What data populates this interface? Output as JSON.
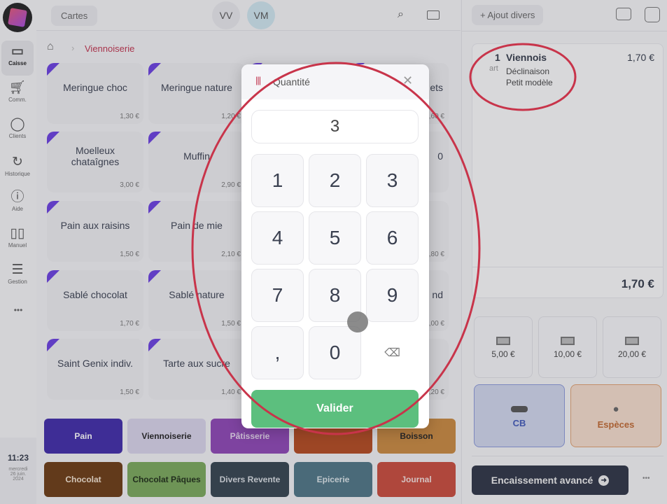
{
  "sidebar": {
    "items": [
      {
        "label": "Caisse",
        "icon": "register-icon"
      },
      {
        "label": "Comm.",
        "icon": "cart-icon"
      },
      {
        "label": "Clients",
        "icon": "user-icon"
      },
      {
        "label": "Historique",
        "icon": "history-icon"
      },
      {
        "label": "Aide",
        "icon": "help-icon"
      },
      {
        "label": "Manuel",
        "icon": "book-icon"
      },
      {
        "label": "Gestion",
        "icon": "sliders-icon"
      }
    ],
    "more": "•••",
    "time": "11:23",
    "date_line1": "mercredi",
    "date_line2": "26 juin.",
    "date_line3": "2024"
  },
  "header": {
    "cartes": "Cartes",
    "users": [
      "VV",
      "VM"
    ]
  },
  "breadcrumb": {
    "current": "Viennoiserie"
  },
  "products": [
    {
      "name": "Meringue choc",
      "price": "1,30 €"
    },
    {
      "name": "Meringue nature",
      "price": "1,20 €"
    },
    {
      "name": "",
      "price": ""
    },
    {
      "name": "ets",
      "price": ",60 €"
    },
    {
      "name": "Moelleux chataîgnes",
      "price": "3,00 €"
    },
    {
      "name": "Muffin",
      "price": "2,90 €"
    },
    {
      "name": "",
      "price": ""
    },
    {
      "name": "0",
      "price": ""
    },
    {
      "name": "Pain aux raisins",
      "price": "1,50 €"
    },
    {
      "name": "Pain de mie",
      "price": "2,10 €"
    },
    {
      "name": "",
      "price": ""
    },
    {
      "name": "",
      "price": ",80 €"
    },
    {
      "name": "Sablé chocolat",
      "price": "1,70 €"
    },
    {
      "name": "Sablé nature",
      "price": "1,50 €"
    },
    {
      "name": "",
      "price": ""
    },
    {
      "name": "nd",
      "price": ",00 €"
    },
    {
      "name": "Saint Genix indiv.",
      "price": "1,50 €"
    },
    {
      "name": "Tarte aux sucre",
      "price": "1,40 €"
    },
    {
      "name": "",
      "price": ""
    },
    {
      "name": "",
      "price": ",20 €"
    }
  ],
  "categories": [
    {
      "label": "Pain",
      "color": "#3f2aa8",
      "text": "#fff"
    },
    {
      "label": "Viennoiserie",
      "color": "#d8d3ea",
      "text": "#222"
    },
    {
      "label": "Pâtisserie",
      "color": "#8d45b4",
      "text": "#e8d8f0"
    },
    {
      "label": "",
      "color": "#b2481e",
      "text": "#fff"
    },
    {
      "label": "Boisson",
      "color": "#c8883e",
      "text": "#222"
    },
    {
      "label": "Chocolat",
      "color": "#6b3a12",
      "text": "#f3e3d0"
    },
    {
      "label": "Chocolat Pâques",
      "color": "#79a85a",
      "text": "#1c2a14"
    },
    {
      "label": "Divers Revente",
      "color": "#34434d",
      "text": "#d8dde2"
    },
    {
      "label": "Epicerie",
      "color": "#4d7584",
      "text": "#dce6ea"
    },
    {
      "label": "Journal",
      "color": "#c84a3a",
      "text": "#f6e0dc"
    }
  ],
  "right": {
    "ajout": "Ajout divers",
    "line": {
      "qty": "1",
      "unit": "art",
      "name": "Viennois",
      "detail1": "Déclinaison",
      "detail2": "Petit modèle",
      "price": "1,70 €"
    },
    "total": "1,70 €",
    "cash": [
      "5,00 €",
      "10,00 €",
      "20,00 €"
    ],
    "cb": "CB",
    "especes": "Espèces",
    "encaissement": "Encaissement avancé",
    "more": "•••"
  },
  "modal": {
    "title": "Quantité",
    "value": "3",
    "keys": [
      "1",
      "2",
      "3",
      "4",
      "5",
      "6",
      "7",
      "8",
      "9",
      ",",
      "0"
    ],
    "validate": "Valider"
  },
  "colors": {
    "accent": "#c0334d",
    "validate": "#5cbf7e",
    "annotation": "#c8344a"
  }
}
